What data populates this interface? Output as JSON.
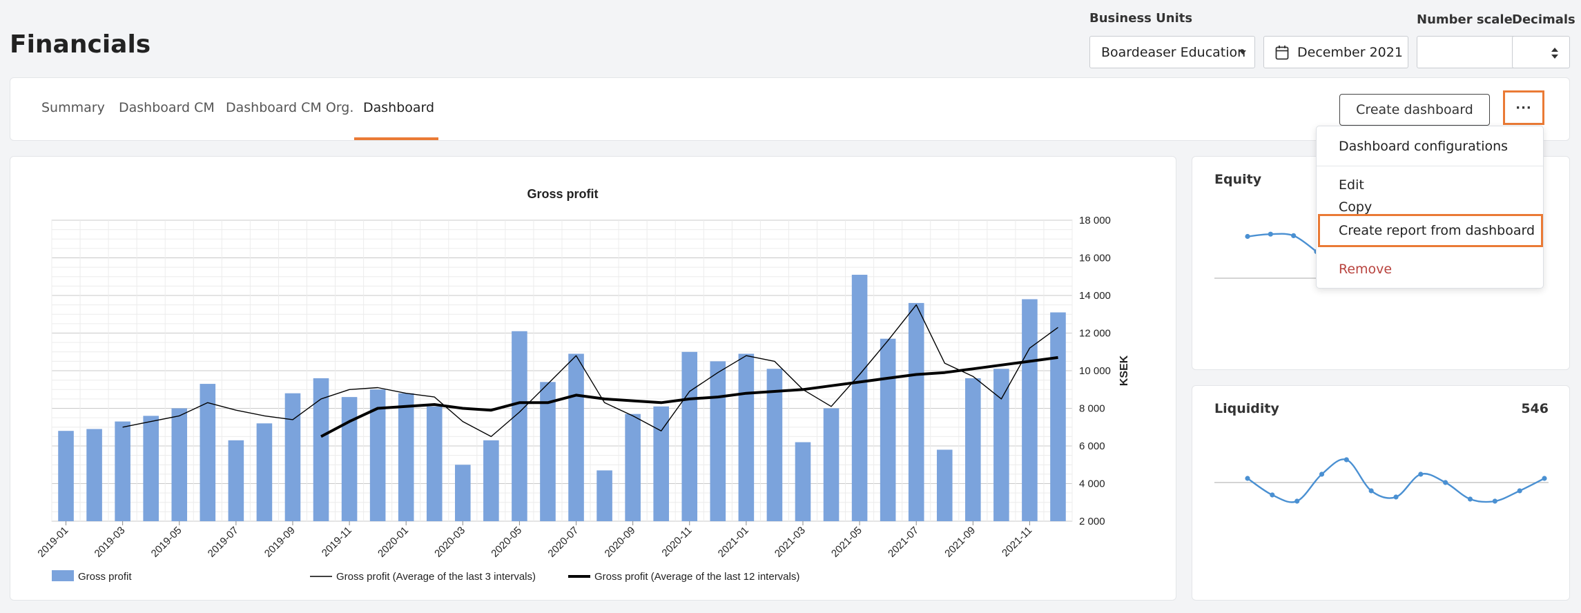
{
  "page_title": "Financials",
  "filters": {
    "business_units_label": "Business Units",
    "business_unit_value": "Boardeaser Education",
    "date_value": "December 2021",
    "number_scale_label": "Number scale",
    "number_scale_value": "",
    "decimals_label": "Decimals",
    "decimals_value": ""
  },
  "tabs": [
    {
      "label": "Summary"
    },
    {
      "label": "Dashboard CM"
    },
    {
      "label": "Dashboard CM Org."
    },
    {
      "label": "Dashboard",
      "active": true
    }
  ],
  "toolbar": {
    "create_dashboard_label": "Create dashboard",
    "more_label": "···"
  },
  "menu": {
    "items": [
      {
        "label": "Dashboard configurations"
      },
      {
        "label": "Edit"
      },
      {
        "label": "Copy"
      },
      {
        "label": "Create report from dashboard"
      },
      {
        "label": "Remove"
      }
    ]
  },
  "colors": {
    "accent": "#ea7a35",
    "bar": "#7ba3dc",
    "sparkline": "#4a90d2",
    "danger": "#b8433e"
  },
  "chart_data": {
    "type": "bar",
    "title": "Gross profit",
    "ylabel": "KSEK",
    "ylim": [
      2000,
      18000
    ],
    "yticks": [
      "2 000",
      "4 000",
      "6 000",
      "8 000",
      "10 000",
      "12 000",
      "14 000",
      "16 000",
      "18 000"
    ],
    "grid": true,
    "legend_position": "bottom",
    "x_tick_labels": [
      "2019-01",
      "2019-03",
      "2019-05",
      "2019-07",
      "2019-09",
      "2019-11",
      "2020-01",
      "2020-03",
      "2020-05",
      "2020-07",
      "2020-09",
      "2020-11",
      "2021-01",
      "2021-03",
      "2021-05",
      "2021-07",
      "2021-09",
      "2021-11"
    ],
    "categories": [
      "2019-01",
      "2019-02",
      "2019-03",
      "2019-04",
      "2019-05",
      "2019-06",
      "2019-07",
      "2019-08",
      "2019-09",
      "2019-10",
      "2019-11",
      "2019-12",
      "2020-01",
      "2020-02",
      "2020-03",
      "2020-04",
      "2020-05",
      "2020-06",
      "2020-07",
      "2020-08",
      "2020-09",
      "2020-10",
      "2020-11",
      "2020-12",
      "2021-01",
      "2021-02",
      "2021-03",
      "2021-04",
      "2021-05",
      "2021-06",
      "2021-07",
      "2021-08",
      "2021-09",
      "2021-10",
      "2021-11",
      "2021-12"
    ],
    "series": [
      {
        "name": "Gross profit",
        "type": "bar",
        "values": [
          6800,
          6900,
          7300,
          7600,
          8000,
          9300,
          6300,
          7200,
          8800,
          9600,
          8600,
          9000,
          8800,
          8100,
          5000,
          6300,
          12100,
          9400,
          10900,
          4700,
          7700,
          8100,
          11000,
          10500,
          10900,
          10100,
          6200,
          8000,
          15100,
          11700,
          13600,
          5800,
          9600,
          10100,
          13800,
          13100
        ]
      },
      {
        "name": "Gross profit (Average of the last 3 intervals)",
        "type": "line",
        "values": [
          null,
          null,
          7000,
          7300,
          7600,
          8300,
          7900,
          7600,
          7400,
          8500,
          9000,
          9100,
          8800,
          8600,
          7300,
          6500,
          7800,
          9300,
          10800,
          8300,
          7600,
          6800,
          8900,
          9900,
          10800,
          10500,
          9000,
          8100,
          9800,
          11600,
          13500,
          10400,
          9700,
          8500,
          11200,
          12300
        ]
      },
      {
        "name": "Gross profit (Average of the last 12 intervals)",
        "type": "line",
        "values": [
          null,
          null,
          null,
          null,
          null,
          null,
          null,
          null,
          null,
          6500,
          7300,
          8000,
          8100,
          8200,
          8000,
          7900,
          8300,
          8300,
          8700,
          8500,
          8400,
          8300,
          8500,
          8600,
          8800,
          8900,
          9000,
          9200,
          9400,
          9600,
          9800,
          9900,
          10100,
          10300,
          10500,
          10700
        ]
      }
    ],
    "legend": [
      "Gross profit",
      "Gross profit (Average of the last 3 intervals)",
      "Gross profit (Average of the last 12 intervals)"
    ]
  },
  "equity": {
    "title": "Equity",
    "value": "",
    "sparkline": [
      0.55,
      0.58,
      0.56,
      0.35
    ]
  },
  "liquidity": {
    "title": "Liquidity",
    "value": "546",
    "sparkline": [
      0.1,
      -0.3,
      -0.45,
      0.2,
      0.55,
      -0.2,
      -0.35,
      0.2,
      0.0,
      -0.4,
      -0.45,
      -0.2,
      0.1
    ]
  }
}
